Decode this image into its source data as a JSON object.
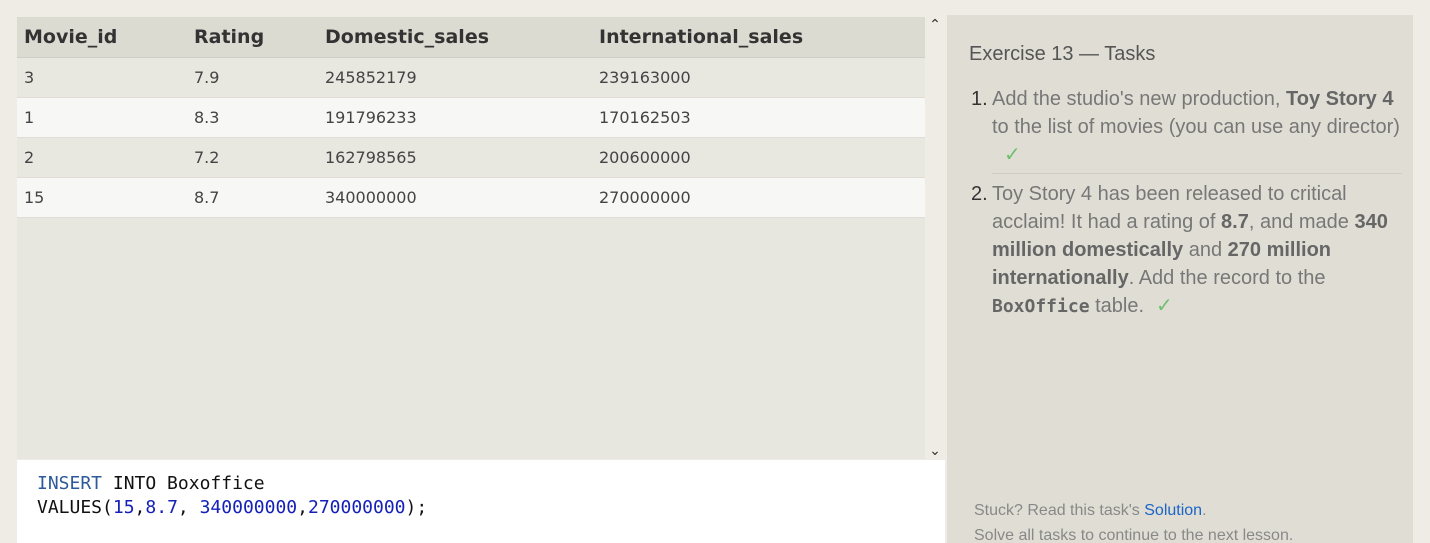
{
  "table": {
    "columns": [
      "Movie_id",
      "Rating",
      "Domestic_sales",
      "International_sales"
    ],
    "rows": [
      [
        "3",
        "7.9",
        "245852179",
        "239163000"
      ],
      [
        "1",
        "8.3",
        "191796233",
        "170162503"
      ],
      [
        "2",
        "7.2",
        "162798565",
        "200600000"
      ],
      [
        "15",
        "8.7",
        "340000000",
        "270000000"
      ]
    ]
  },
  "scrollbar": {
    "up": "⌃",
    "down": "⌄"
  },
  "editor": {
    "line1_kw": "INSERT",
    "line1_rest": " INTO Boxoffice",
    "line2_fn": "VALUES(",
    "v1": "15",
    "c1": ",",
    "v2": "8.7",
    "c2": ", ",
    "v3": "340000000",
    "c3": ",",
    "v4": "270000000",
    "end": ");"
  },
  "tasks": {
    "title": "Exercise 13 — Tasks",
    "items": [
      {
        "num": "1.",
        "pre": "Add the studio's new production, ",
        "bold": "Toy Story 4",
        "post": " to the list of movies (you can use any director)",
        "check": "✓"
      },
      {
        "num": "2.",
        "pre": "Toy Story 4 has been released to critical acclaim! It had a rating of ",
        "b1": "8.7",
        "mid1": ", and made ",
        "b2": "340 million domestically",
        "mid2": " and ",
        "b3": "270 million internationally",
        "mid3": ". Add the record to the ",
        "code": "BoxOffice",
        "post": " table.",
        "check": "✓"
      }
    ]
  },
  "footer": {
    "line1_pre": "Stuck? Read this task's ",
    "solution_link": "Solution",
    "line1_post": ".",
    "line2": "Solve all tasks to continue to the next lesson."
  }
}
